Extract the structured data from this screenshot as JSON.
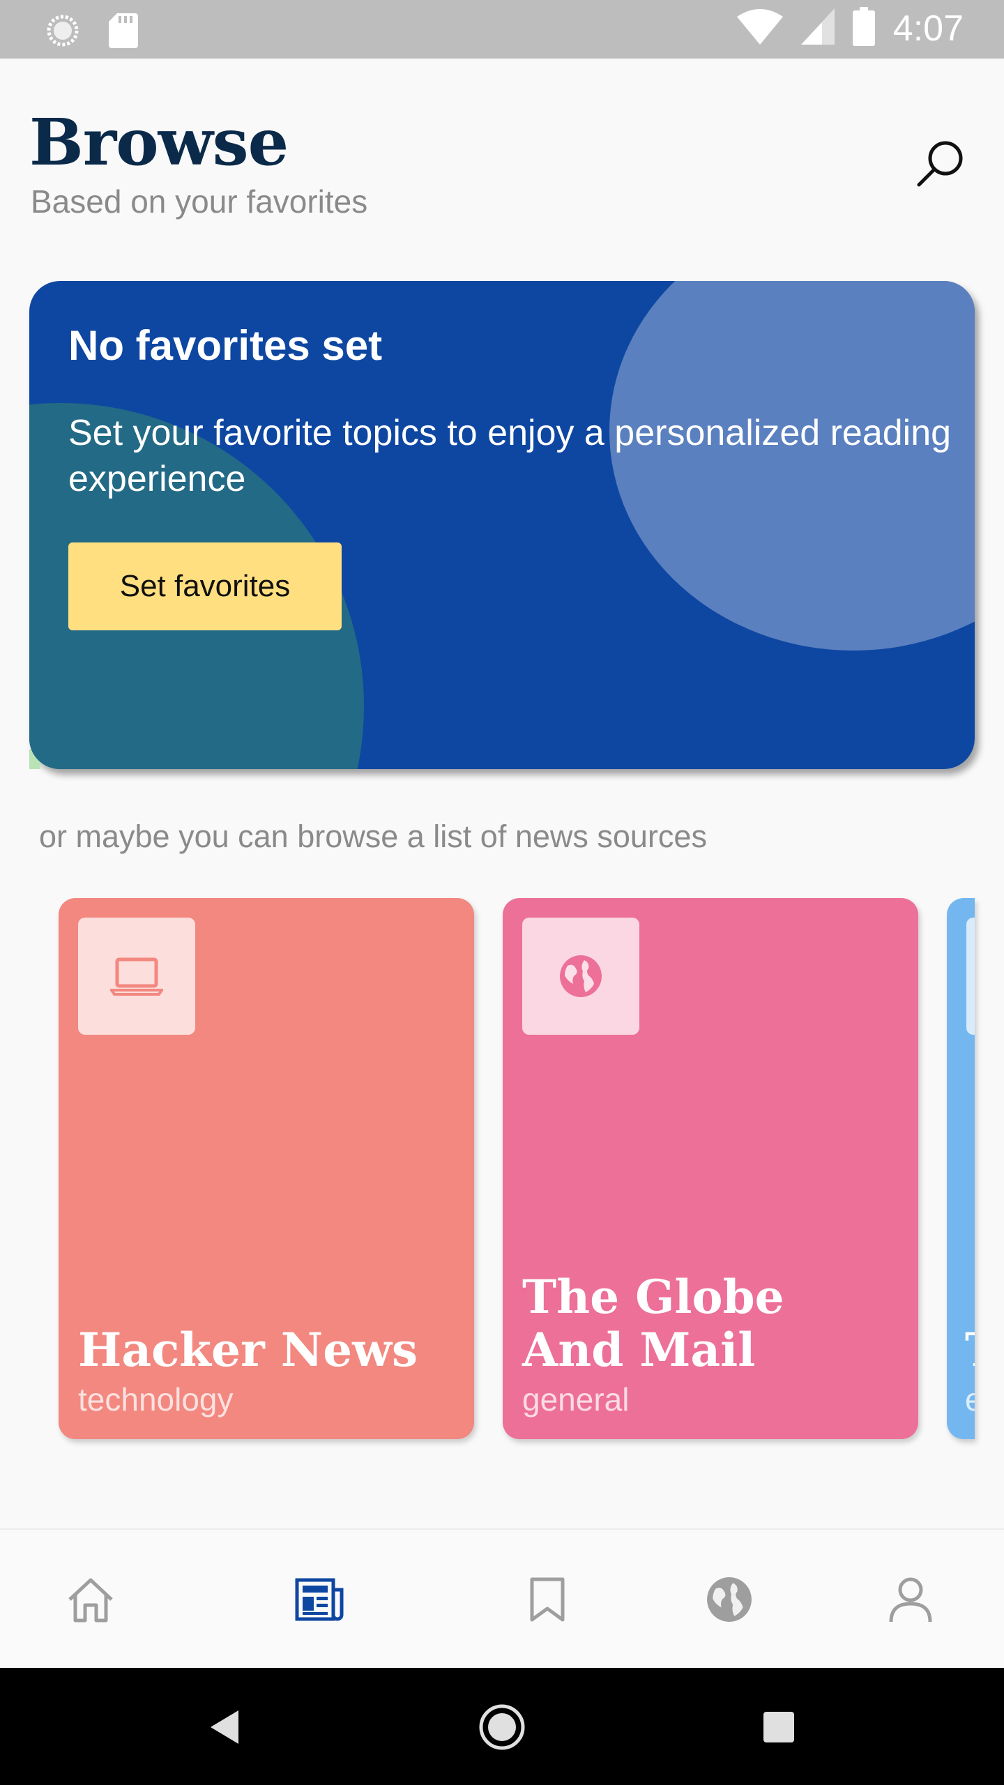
{
  "status_bar": {
    "time": "4:07",
    "icons": [
      "sync-icon",
      "sd-card-icon",
      "wifi-icon",
      "signal-icon",
      "battery-icon"
    ]
  },
  "header": {
    "title": "Browse",
    "subtitle": "Based on your favorites",
    "search_icon": "search-icon"
  },
  "favorites_card": {
    "title": "No favorites set",
    "description": "Set your favorite topics to enjoy a personalized reading experience",
    "button_label": "Set favorites",
    "colors": {
      "background": "#0e47a1",
      "button": "#ffdf80"
    }
  },
  "hint": "or maybe you can browse a list of news sources",
  "sources": [
    {
      "name": "Hacker News",
      "category": "technology",
      "icon": "laptop-icon",
      "color": "#f28880"
    },
    {
      "name": "The Globe And Mail",
      "category": "general",
      "icon": "globe-icon",
      "color": "#ed7099"
    },
    {
      "name": "T",
      "category": "e",
      "icon": "unknown-icon",
      "color": "#74b7f0"
    }
  ],
  "bottom_nav": {
    "items": [
      {
        "id": "home",
        "icon": "home-icon",
        "active": false
      },
      {
        "id": "news",
        "icon": "newspaper-icon",
        "active": true
      },
      {
        "id": "bookmarks",
        "icon": "bookmark-icon",
        "active": false
      },
      {
        "id": "explore",
        "icon": "globe-icon",
        "active": false
      },
      {
        "id": "profile",
        "icon": "person-icon",
        "active": false
      }
    ],
    "active_color": "#0e47a1",
    "inactive_color": "#9e9e9e"
  },
  "system_nav": {
    "icons": [
      "back-icon",
      "home-icon",
      "recents-icon"
    ]
  }
}
